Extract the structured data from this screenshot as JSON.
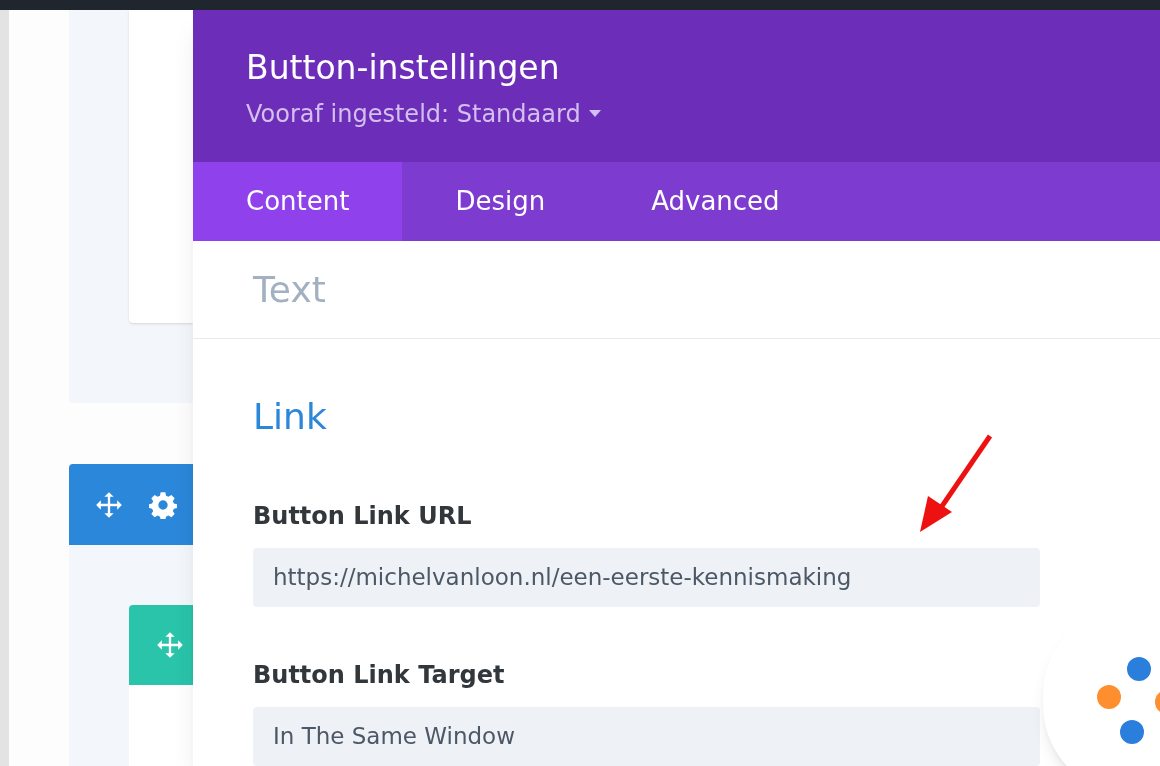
{
  "modal": {
    "title": "Button-instellingen",
    "preset": "Vooraf ingesteld: Standaard"
  },
  "tabs": [
    {
      "label": "Content",
      "selected": true
    },
    {
      "label": "Design",
      "selected": false
    },
    {
      "label": "Advanced",
      "selected": false
    }
  ],
  "sections": [
    {
      "title": "Text",
      "expanded": false
    },
    {
      "title": "Link",
      "expanded": true,
      "fields": [
        {
          "label": "Button Link URL",
          "value": "https://michelvanloon.nl/een-eerste-kennismaking"
        },
        {
          "label": "Button Link Target",
          "value": "In The Same Window"
        }
      ]
    }
  ]
}
